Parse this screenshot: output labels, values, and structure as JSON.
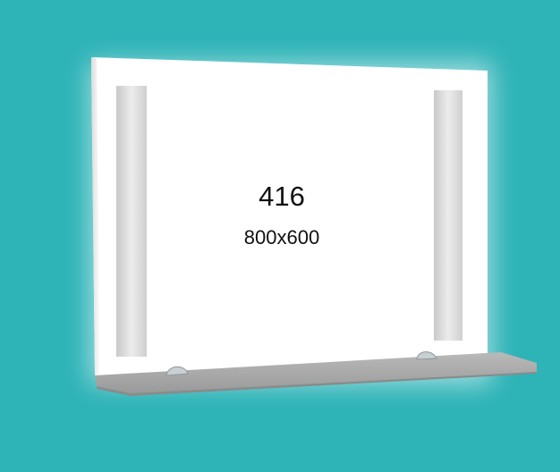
{
  "product": {
    "model_number": "416",
    "dimensions": "800x600"
  },
  "colors": {
    "background": "#2eb3b7",
    "mirror": "#ffffff",
    "frosted_strip": "#d9d9d9",
    "shelf": "#a8a8a8"
  }
}
